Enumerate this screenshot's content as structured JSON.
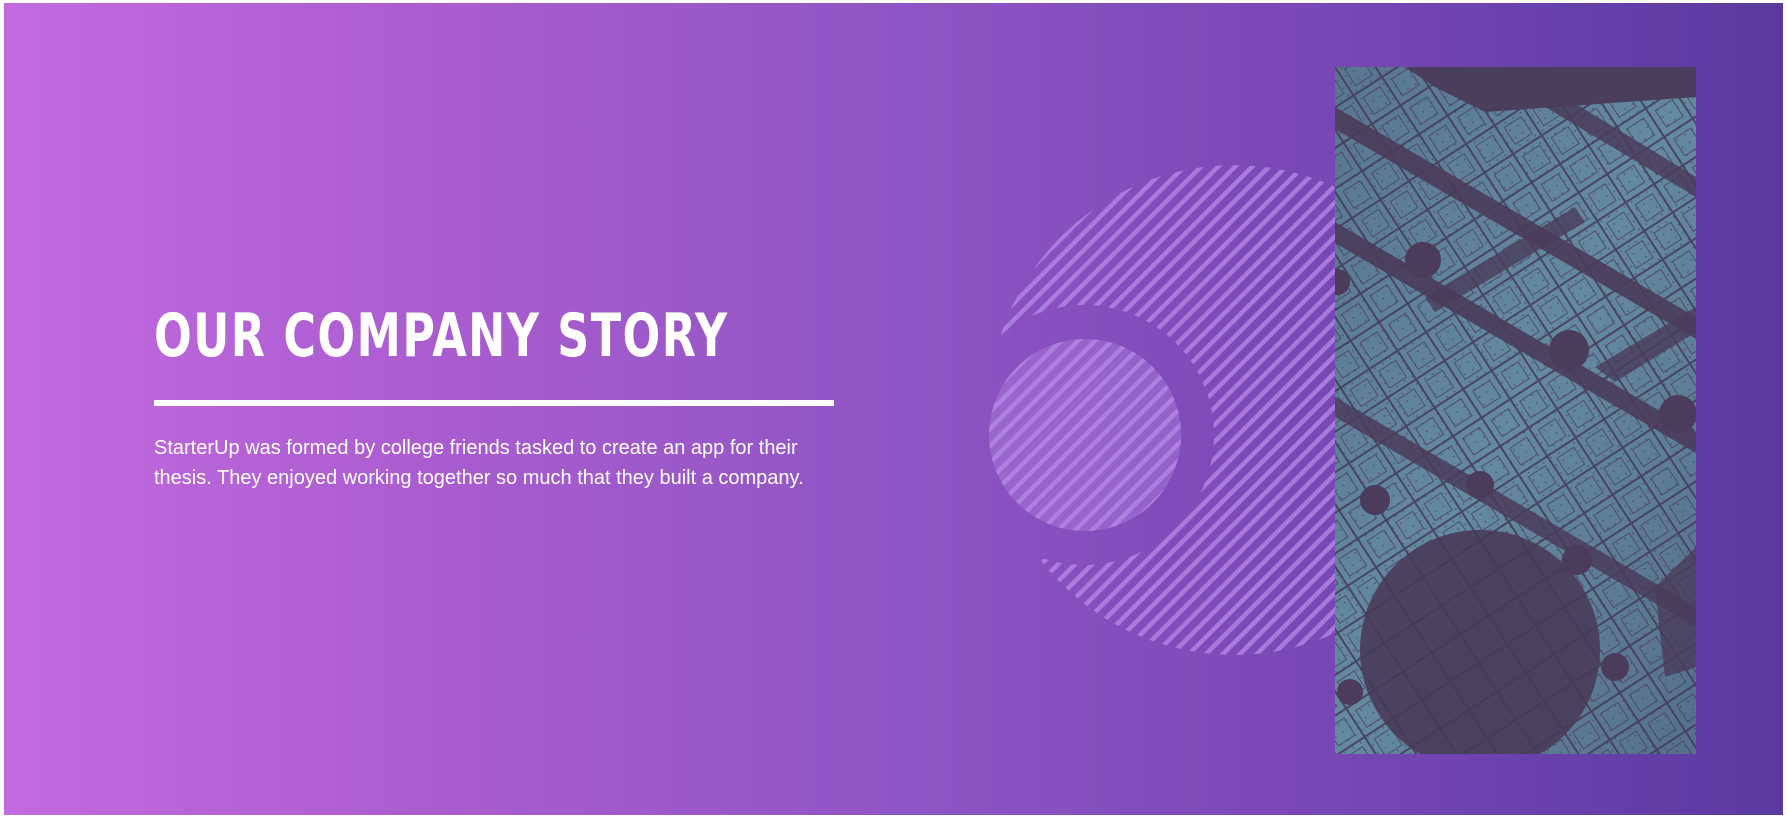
{
  "hero": {
    "title": "OUR COMPANY STORY",
    "description": "StarterUp was formed by college friends tasked to create an app for their thesis. They enjoyed working together so much that they built a company."
  },
  "colors": {
    "gradient_start": "#c36ae0",
    "gradient_end": "#5a3aa0",
    "text": "#ffffff",
    "stripes": "#b58ae6",
    "photo_tone": "#5e7f97"
  },
  "images": {
    "photo_icon": "abstract-3d-maze-image",
    "decoration_icon": "striped-circles-decoration"
  }
}
